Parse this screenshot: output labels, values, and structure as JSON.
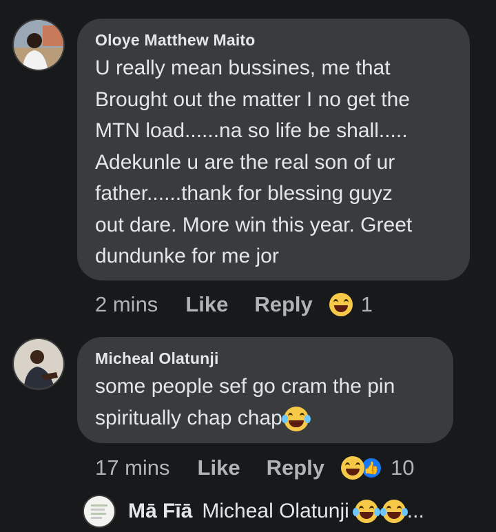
{
  "comments": [
    {
      "author": "Oloye Matthew Maito",
      "text_lines": [
        "U really mean bussines, me that",
        "Brought out the matter I no get the",
        "MTN load......na so life be shall.....",
        "Adekunle u are the real son of ur",
        "father......thank for blessing guyz",
        "out dare. More win this year. Greet",
        "dundunke for me jor"
      ],
      "time": "2 mins",
      "like_label": "Like",
      "reply_label": "Reply",
      "reaction_count": "1",
      "reactions": [
        "laughing-emoji"
      ]
    },
    {
      "author": "Micheal Olatunji",
      "text_lines": [
        "some people sef go cram the pin",
        "spiritually chap chap"
      ],
      "time": "17 mins",
      "like_label": "Like",
      "reply_label": "Reply",
      "reaction_count": "10",
      "reactions": [
        "laughing-emoji",
        "like-icon"
      ]
    }
  ],
  "reply_preview": {
    "author": "Mā Fīā",
    "text": "Micheal Olatunji",
    "ellipsis": "..."
  },
  "colors": {
    "background": "#18191a",
    "bubble": "#3a3b3c",
    "text": "#e4e6eb",
    "secondary_text": "#b0b3b8",
    "like_blue": "#1877f2"
  }
}
